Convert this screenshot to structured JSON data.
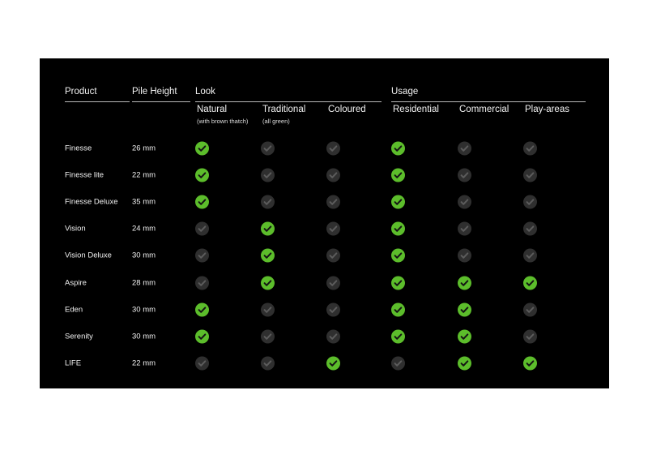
{
  "panel": {
    "background": "#000000",
    "accent_on": "#5cbd2b",
    "accent_off": "#2f2f2f"
  },
  "headers": {
    "product": "Product",
    "pile_height": "Pile Height",
    "look": "Look",
    "usage": "Usage"
  },
  "columns": [
    {
      "key": "natural",
      "title": "Natural",
      "note": "(with brown thatch)",
      "group": "look"
    },
    {
      "key": "traditional",
      "title": "Traditional",
      "note": "(all green)",
      "group": "look"
    },
    {
      "key": "coloured",
      "title": "Coloured",
      "note": "",
      "group": "look"
    },
    {
      "key": "residential",
      "title": "Residential",
      "note": "",
      "group": "usage"
    },
    {
      "key": "commercial",
      "title": "Commercial",
      "note": "",
      "group": "usage"
    },
    {
      "key": "play_areas",
      "title": "Play-areas",
      "note": "",
      "group": "usage"
    }
  ],
  "rows": [
    {
      "product": "Finesse",
      "pile_height": "26 mm",
      "natural": true,
      "traditional": false,
      "coloured": false,
      "residential": true,
      "commercial": false,
      "play_areas": false
    },
    {
      "product": "Finesse lite",
      "pile_height": "22 mm",
      "natural": true,
      "traditional": false,
      "coloured": false,
      "residential": true,
      "commercial": false,
      "play_areas": false
    },
    {
      "product": "Finesse Deluxe",
      "pile_height": "35 mm",
      "natural": true,
      "traditional": false,
      "coloured": false,
      "residential": true,
      "commercial": false,
      "play_areas": false
    },
    {
      "product": "Vision",
      "pile_height": "24 mm",
      "natural": false,
      "traditional": true,
      "coloured": false,
      "residential": true,
      "commercial": false,
      "play_areas": false
    },
    {
      "product": "Vision Deluxe",
      "pile_height": "30 mm",
      "natural": false,
      "traditional": true,
      "coloured": false,
      "residential": true,
      "commercial": false,
      "play_areas": false
    },
    {
      "product": "Aspire",
      "pile_height": "28 mm",
      "natural": false,
      "traditional": true,
      "coloured": false,
      "residential": true,
      "commercial": true,
      "play_areas": true
    },
    {
      "product": "Eden",
      "pile_height": "30 mm",
      "natural": true,
      "traditional": false,
      "coloured": false,
      "residential": true,
      "commercial": true,
      "play_areas": false
    },
    {
      "product": "Serenity",
      "pile_height": "30 mm",
      "natural": true,
      "traditional": false,
      "coloured": false,
      "residential": true,
      "commercial": true,
      "play_areas": false
    },
    {
      "product": "LIFE",
      "pile_height": "22 mm",
      "natural": false,
      "traditional": false,
      "coloured": true,
      "residential": false,
      "commercial": true,
      "play_areas": true
    }
  ]
}
